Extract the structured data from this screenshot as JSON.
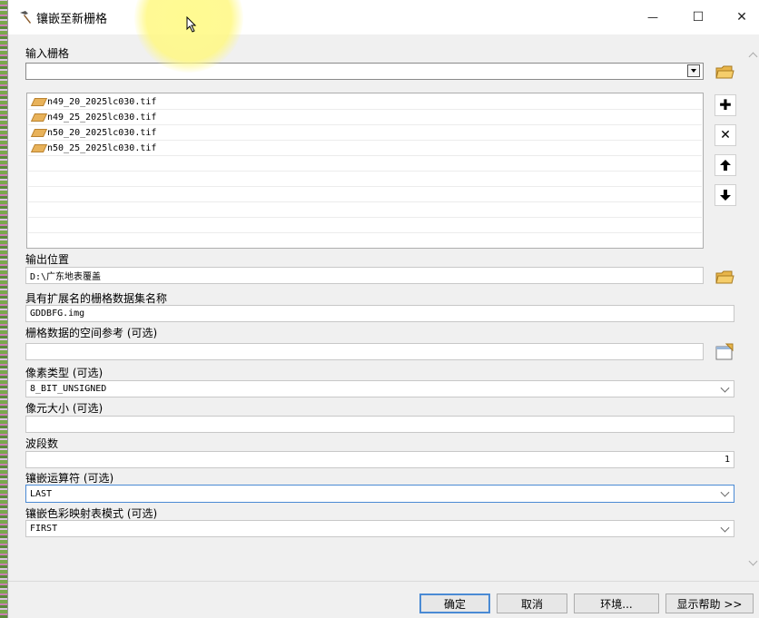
{
  "window": {
    "title": "镶嵌至新栅格",
    "minimize": "—",
    "maximize": "☐",
    "close": "✕"
  },
  "input_rasters": {
    "label": "输入栅格",
    "value": "",
    "items": [
      "n49_20_2025lc030.tif",
      "n49_25_2025lc030.tif",
      "n50_20_2025lc030.tif",
      "n50_25_2025lc030.tif"
    ],
    "buttons": {
      "add": "✚",
      "remove": "✕",
      "up": "🡅",
      "down": "🡇"
    }
  },
  "output_location": {
    "label": "输出位置",
    "value": "D:\\广东地表覆盖"
  },
  "dataset_name": {
    "label": "具有扩展名的栅格数据集名称",
    "value": "GDDBFG.img"
  },
  "spatial_ref": {
    "label": "栅格数据的空间参考 (可选)",
    "value": ""
  },
  "pixel_type": {
    "label": "像素类型 (可选)",
    "value": "8_BIT_UNSIGNED"
  },
  "cell_size": {
    "label": "像元大小 (可选)",
    "value": ""
  },
  "bands": {
    "label": "波段数",
    "value": "1"
  },
  "mosaic_operator": {
    "label": "镶嵌运算符 (可选)",
    "value": "LAST"
  },
  "colormap_mode": {
    "label": "镶嵌色彩映射表模式 (可选)",
    "value": "FIRST"
  },
  "footer": {
    "ok": "确定",
    "cancel": "取消",
    "environments": "环境...",
    "show_help": "显示帮助 >>"
  },
  "colors": {
    "accent_border": "#4a8ad4",
    "highlight": "#fff88a"
  }
}
